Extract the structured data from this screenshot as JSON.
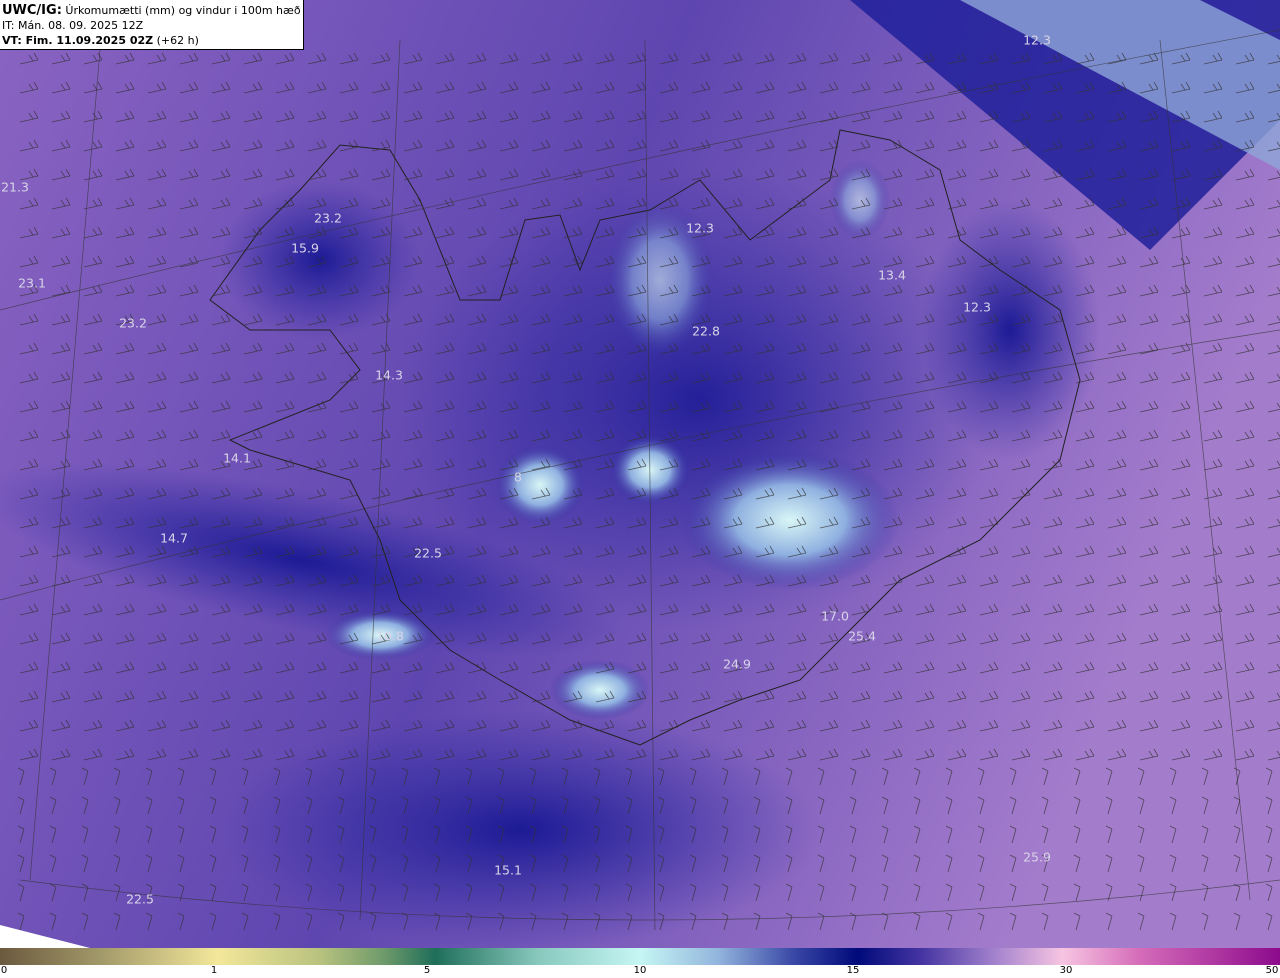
{
  "header": {
    "model": "UWC/IG:",
    "title": "Úrkomumætti (mm) og vindur i 100m hæð",
    "init_time": "IT: Mán. 08. 09. 2025 12Z",
    "valid_label": "VT: Fim. 11.09.2025 02Z",
    "lead": "(+62 h)"
  },
  "labels": [
    "12.3",
    "21.3",
    "23.2",
    "15.9",
    "23.1",
    "23.2",
    "12.3",
    "13.4",
    "12.3",
    "22.8",
    "14.3",
    "14.1",
    "8",
    "14.7",
    "22.5",
    "10.8",
    "17.0",
    "25.4",
    "24.9",
    "25.9",
    "15.1",
    "22.5"
  ],
  "colorbar": {
    "unit": "mm",
    "ticks": [
      "0",
      "1",
      "5",
      "10",
      "15",
      "30",
      "50"
    ]
  }
}
